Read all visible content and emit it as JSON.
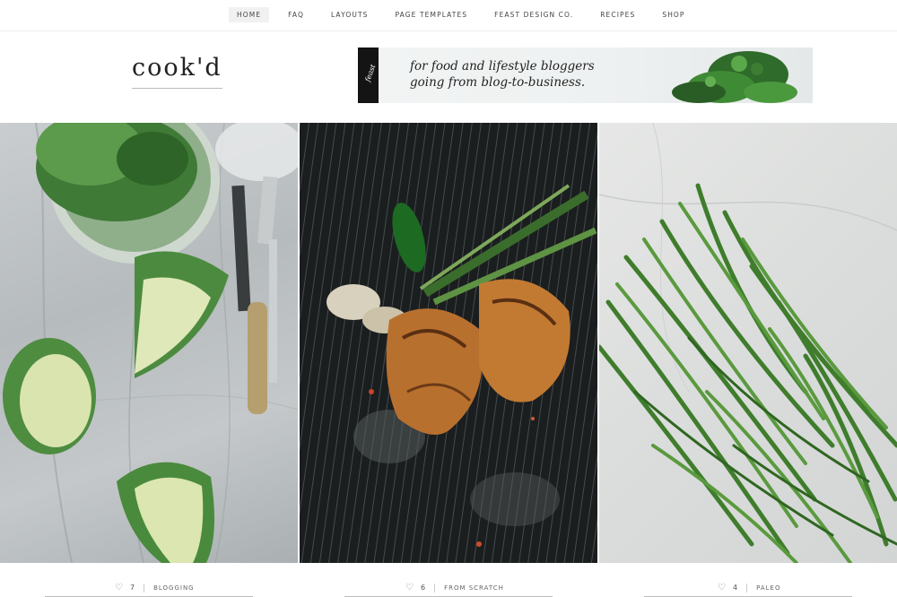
{
  "nav": {
    "items": [
      {
        "label": "HOME",
        "active": true
      },
      {
        "label": "FAQ"
      },
      {
        "label": "LAYOUTS"
      },
      {
        "label": "PAGE TEMPLATES"
      },
      {
        "label": "FEAST DESIGN CO."
      },
      {
        "label": "RECIPES"
      },
      {
        "label": "SHOP"
      }
    ]
  },
  "header": {
    "logo": "cook'd",
    "banner": {
      "line1": "for food and lifestyle bloggers",
      "line2": "going from blog-to-business."
    }
  },
  "posts": [
    {
      "image_icon": "cabbage-photo",
      "likes": "7",
      "category": "BLOGGING"
    },
    {
      "image_icon": "grill-photo",
      "likes": "6",
      "category": "FROM SCRATCH"
    },
    {
      "image_icon": "green-beans-photo",
      "likes": "4",
      "category": "PALEO"
    }
  ],
  "colors": {
    "accent_dark": "#141414",
    "text": "#222222",
    "nav_active_bg": "#f1f1f1"
  }
}
